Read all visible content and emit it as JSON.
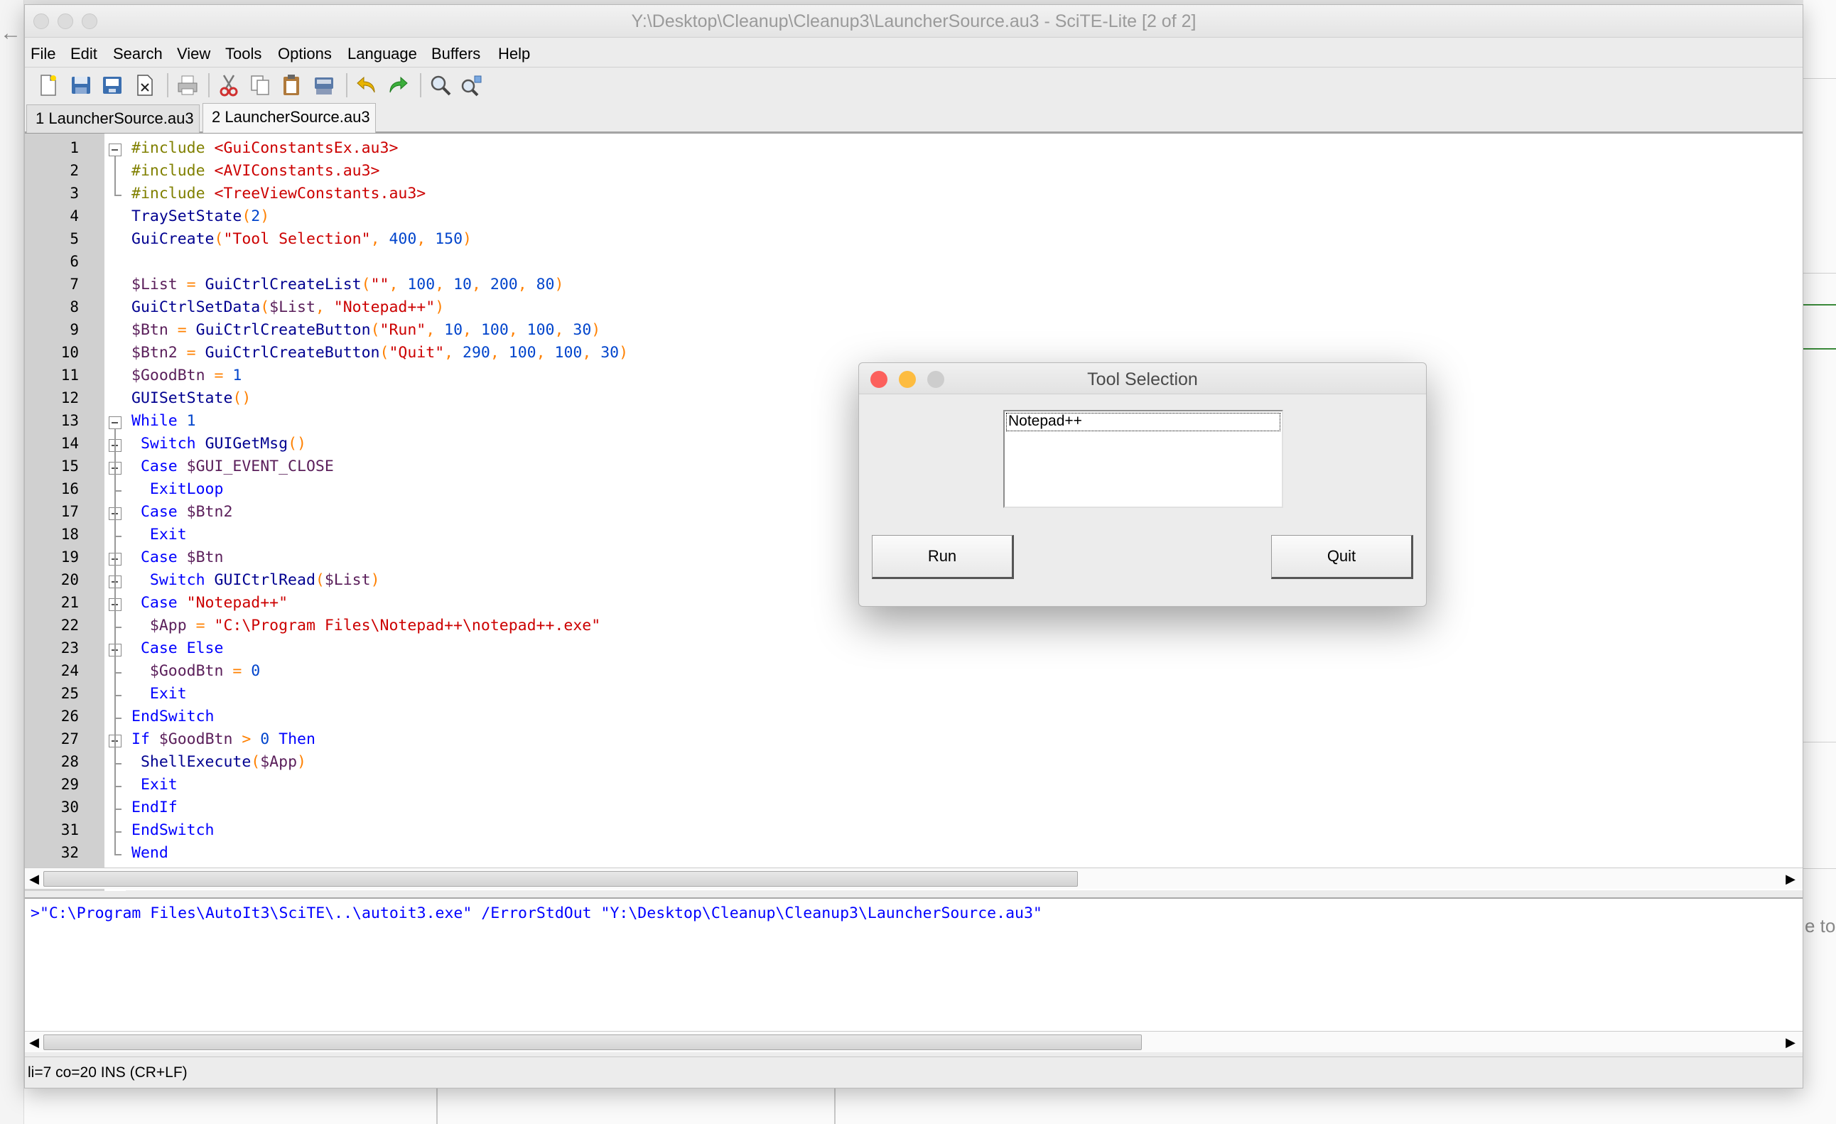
{
  "background": {
    "right_edge_text": "e to",
    "back_arrow": "←"
  },
  "window": {
    "title": "Y:\\Desktop\\Cleanup\\Cleanup3\\LauncherSource.au3 - SciTE-Lite [2 of 2]",
    "menu": [
      "File",
      "Edit",
      "Search",
      "View",
      "Tools",
      "Options",
      "Language",
      "Buffers",
      "Help"
    ],
    "toolbar_icons": [
      "new-file-icon",
      "open-file-icon",
      "save-icon",
      "close-file-icon",
      "print-icon",
      "cut-icon",
      "copy-icon",
      "paste-icon",
      "delete-icon",
      "undo-icon",
      "redo-icon",
      "find-icon",
      "replace-icon"
    ],
    "tabs": [
      {
        "label": "1 LauncherSource.au3",
        "active": false
      },
      {
        "label": "2 LauncherSource.au3",
        "active": true
      }
    ]
  },
  "editor": {
    "line_numbers": [
      "1",
      "2",
      "3",
      "4",
      "5",
      "6",
      "7",
      "8",
      "9",
      "10",
      "11",
      "12",
      "13",
      "14",
      "15",
      "16",
      "17",
      "18",
      "19",
      "20",
      "21",
      "22",
      "23",
      "24",
      "25",
      "26",
      "27",
      "28",
      "29",
      "30",
      "31",
      "32"
    ],
    "lines": [
      [
        [
          "p",
          "#include "
        ],
        [
          "s",
          "<GuiConstantsEx.au3>"
        ]
      ],
      [
        [
          "p",
          "#include "
        ],
        [
          "s",
          "<AVIConstants.au3>"
        ]
      ],
      [
        [
          "p",
          "#include "
        ],
        [
          "s",
          "<TreeViewConstants.au3>"
        ]
      ],
      [
        [
          "f",
          "TraySetState"
        ],
        [
          "o",
          "("
        ],
        [
          "n",
          "2"
        ],
        [
          "o",
          ")"
        ]
      ],
      [
        [
          "f",
          "GuiCreate"
        ],
        [
          "o",
          "("
        ],
        [
          "s",
          "\"Tool Selection\""
        ],
        [
          "o",
          ", "
        ],
        [
          "n",
          "400"
        ],
        [
          "o",
          ", "
        ],
        [
          "n",
          "150"
        ],
        [
          "o",
          ")"
        ]
      ],
      [],
      [
        [
          "v",
          "$List "
        ],
        [
          "o",
          "= "
        ],
        [
          "f",
          "GuiCtrlCreateList"
        ],
        [
          "o",
          "("
        ],
        [
          "s",
          "\"\""
        ],
        [
          "o",
          ", "
        ],
        [
          "n",
          "100"
        ],
        [
          "o",
          ", "
        ],
        [
          "n",
          "10"
        ],
        [
          "o",
          ", "
        ],
        [
          "n",
          "200"
        ],
        [
          "o",
          ", "
        ],
        [
          "n",
          "80"
        ],
        [
          "o",
          ")"
        ]
      ],
      [
        [
          "f",
          "GuiCtrlSetData"
        ],
        [
          "o",
          "("
        ],
        [
          "v",
          "$List"
        ],
        [
          "o",
          ", "
        ],
        [
          "s",
          "\"Notepad++\""
        ],
        [
          "o",
          ")"
        ]
      ],
      [
        [
          "v",
          "$Btn "
        ],
        [
          "o",
          "= "
        ],
        [
          "f",
          "GuiCtrlCreateButton"
        ],
        [
          "o",
          "("
        ],
        [
          "s",
          "\"Run\""
        ],
        [
          "o",
          ", "
        ],
        [
          "n",
          "10"
        ],
        [
          "o",
          ", "
        ],
        [
          "n",
          "100"
        ],
        [
          "o",
          ", "
        ],
        [
          "n",
          "100"
        ],
        [
          "o",
          ", "
        ],
        [
          "n",
          "30"
        ],
        [
          "o",
          ")"
        ]
      ],
      [
        [
          "v",
          "$Btn2 "
        ],
        [
          "o",
          "= "
        ],
        [
          "f",
          "GuiCtrlCreateButton"
        ],
        [
          "o",
          "("
        ],
        [
          "s",
          "\"Quit\""
        ],
        [
          "o",
          ", "
        ],
        [
          "n",
          "290"
        ],
        [
          "o",
          ", "
        ],
        [
          "n",
          "100"
        ],
        [
          "o",
          ", "
        ],
        [
          "n",
          "100"
        ],
        [
          "o",
          ", "
        ],
        [
          "n",
          "30"
        ],
        [
          "o",
          ")"
        ]
      ],
      [
        [
          "v",
          "$GoodBtn "
        ],
        [
          "o",
          "= "
        ],
        [
          "n",
          "1"
        ]
      ],
      [
        [
          "f",
          "GUISetState"
        ],
        [
          "o",
          "()"
        ]
      ],
      [
        [
          "k",
          "While "
        ],
        [
          "n",
          "1"
        ]
      ],
      [
        [
          "k",
          " Switch "
        ],
        [
          "f",
          "GUIGetMsg"
        ],
        [
          "o",
          "()"
        ]
      ],
      [
        [
          "k",
          " Case "
        ],
        [
          "v",
          "$GUI_EVENT_CLOSE"
        ]
      ],
      [
        [
          "k",
          "  ExitLoop"
        ]
      ],
      [
        [
          "k",
          " Case "
        ],
        [
          "v",
          "$Btn2"
        ]
      ],
      [
        [
          "k",
          "  Exit"
        ]
      ],
      [
        [
          "k",
          " Case "
        ],
        [
          "v",
          "$Btn"
        ]
      ],
      [
        [
          "k",
          "  Switch "
        ],
        [
          "f",
          "GUICtrlRead"
        ],
        [
          "o",
          "("
        ],
        [
          "v",
          "$List"
        ],
        [
          "o",
          ")"
        ]
      ],
      [
        [
          "k",
          " Case "
        ],
        [
          "s",
          "\"Notepad++\""
        ]
      ],
      [
        [
          "v",
          "  $App "
        ],
        [
          "o",
          "= "
        ],
        [
          "s",
          "\"C:\\Program Files\\Notepad++\\notepad++.exe\""
        ]
      ],
      [
        [
          "k",
          " Case Else"
        ]
      ],
      [
        [
          "v",
          "  $GoodBtn "
        ],
        [
          "o",
          "= "
        ],
        [
          "n",
          "0"
        ]
      ],
      [
        [
          "k",
          "  Exit"
        ]
      ],
      [
        [
          "k",
          "EndSwitch"
        ]
      ],
      [
        [
          "k",
          "If "
        ],
        [
          "v",
          "$GoodBtn "
        ],
        [
          "o",
          "> "
        ],
        [
          "n",
          "0 "
        ],
        [
          "k",
          "Then"
        ]
      ],
      [
        [
          "f",
          " ShellExecute"
        ],
        [
          "o",
          "("
        ],
        [
          "v",
          "$App"
        ],
        [
          "o",
          ")"
        ]
      ],
      [
        [
          "k",
          " Exit"
        ]
      ],
      [
        [
          "k",
          "EndIf"
        ]
      ],
      [
        [
          "k",
          "EndSwitch"
        ]
      ],
      [
        [
          "k",
          "Wend"
        ]
      ]
    ]
  },
  "output": {
    "line": ">\"C:\\Program Files\\AutoIt3\\SciTE\\..\\autoit3.exe\" /ErrorStdOut \"Y:\\Desktop\\Cleanup\\Cleanup3\\LauncherSource.au3\""
  },
  "status": {
    "text": "li=7 co=20 INS (CR+LF)"
  },
  "dialog": {
    "title": "Tool Selection",
    "list_items": [
      "Notepad++"
    ],
    "run_label": "Run",
    "quit_label": "Quit",
    "colors": {
      "close": "#fc605c",
      "minimize": "#fdbc40",
      "zoom": "#cdcdcd"
    }
  },
  "syntax_colors": {
    "keyword": "#0000ff",
    "function": "#000090",
    "string": "#cc0000",
    "number": "#0044cc",
    "operator": "#ff8000",
    "preprocessor": "#808000",
    "variable": "#5a1e5a"
  }
}
